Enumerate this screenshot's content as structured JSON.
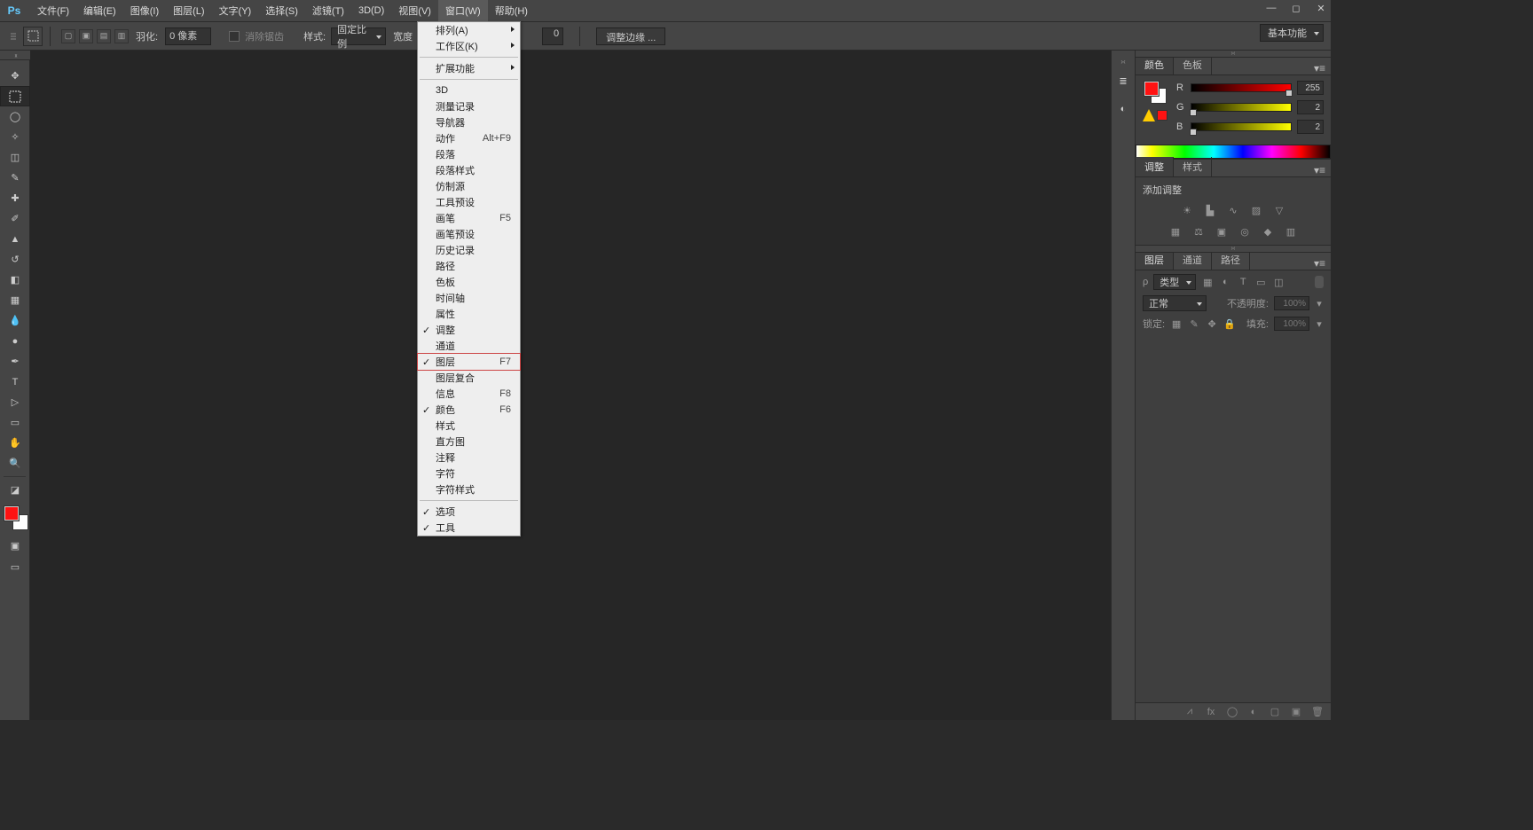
{
  "menubar": {
    "items": [
      "文件(F)",
      "编辑(E)",
      "图像(I)",
      "图层(L)",
      "文字(Y)",
      "选择(S)",
      "滤镜(T)",
      "3D(D)",
      "视图(V)",
      "窗口(W)",
      "帮助(H)"
    ],
    "active_index": 9
  },
  "options": {
    "feather_label": "羽化:",
    "feather_value": "0 像素",
    "antialias_label": "消除锯齿",
    "style_label": "样式:",
    "style_value": "固定比例",
    "width_label": "宽度",
    "trailing_value": "0",
    "adjust_edge": "调整边缘 ..."
  },
  "workspace_switch": "基本功能",
  "window_menu": {
    "groups": [
      [
        {
          "label": "排列(A)",
          "submenu": true
        },
        {
          "label": "工作区(K)",
          "submenu": true
        }
      ],
      [
        {
          "label": "扩展功能",
          "submenu": true
        }
      ],
      [
        {
          "label": "3D"
        },
        {
          "label": "测量记录"
        },
        {
          "label": "导航器"
        },
        {
          "label": "动作",
          "shortcut": "Alt+F9"
        },
        {
          "label": "段落"
        },
        {
          "label": "段落样式"
        },
        {
          "label": "仿制源"
        },
        {
          "label": "工具预设"
        },
        {
          "label": "画笔",
          "shortcut": "F5"
        },
        {
          "label": "画笔预设"
        },
        {
          "label": "历史记录"
        },
        {
          "label": "路径"
        },
        {
          "label": "色板"
        },
        {
          "label": "时间轴"
        },
        {
          "label": "属性"
        },
        {
          "label": "调整",
          "checked": true
        },
        {
          "label": "通道"
        },
        {
          "label": "图层",
          "shortcut": "F7",
          "checked": true,
          "highlighted": true
        },
        {
          "label": "图层复合"
        },
        {
          "label": "信息",
          "shortcut": "F8"
        },
        {
          "label": "颜色",
          "shortcut": "F6",
          "checked": true
        },
        {
          "label": "样式"
        },
        {
          "label": "直方图"
        },
        {
          "label": "注释"
        },
        {
          "label": "字符"
        },
        {
          "label": "字符样式"
        }
      ],
      [
        {
          "label": "选项",
          "checked": true
        },
        {
          "label": "工具",
          "checked": true
        }
      ]
    ]
  },
  "panels": {
    "color": {
      "tabs": [
        "颜色",
        "色板"
      ],
      "r_label": "R",
      "g_label": "G",
      "b_label": "B",
      "r": "255",
      "g": "2",
      "b": "2"
    },
    "adjustments": {
      "tabs": [
        "调整",
        "样式"
      ],
      "title": "添加调整"
    },
    "layers": {
      "tabs": [
        "图层",
        "通道",
        "路径"
      ],
      "kind_label": "类型",
      "blend_mode": "正常",
      "opacity_label": "不透明度:",
      "opacity": "100%",
      "lock_label": "锁定:",
      "fill_label": "填充:",
      "fill": "100%"
    }
  }
}
